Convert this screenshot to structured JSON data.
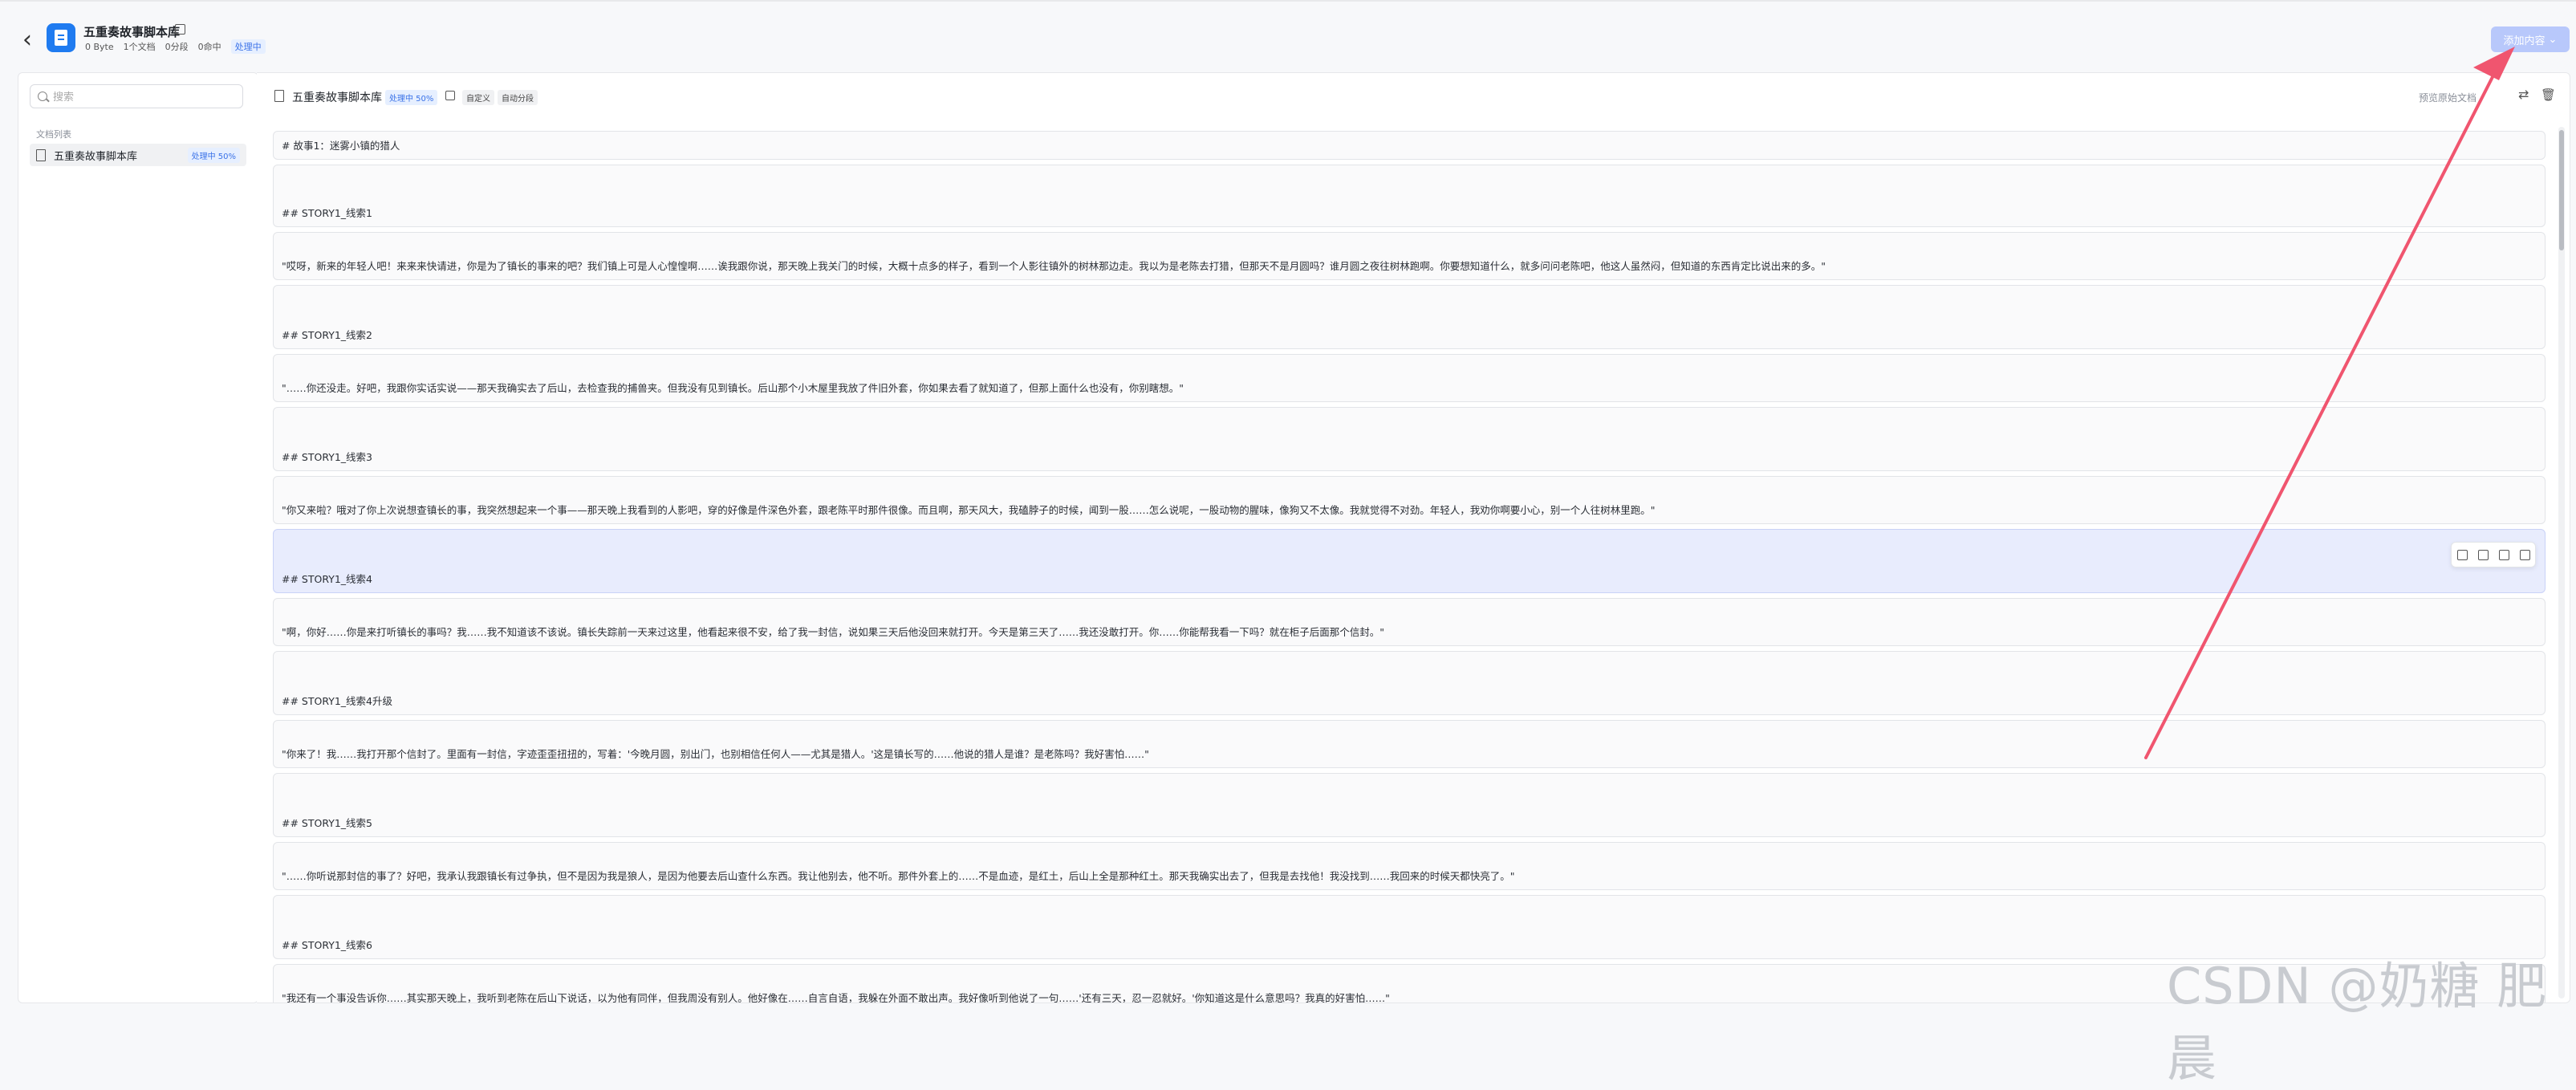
{
  "header": {
    "back_icon": "chevron-left-icon",
    "kb_title": "五重奏故事脚本库",
    "stats": [
      "0 Byte",
      "1个文档",
      "0分段",
      "0命中"
    ],
    "status": "处理中",
    "add_button": "添加内容"
  },
  "sidebar": {
    "search_placeholder": "搜索",
    "list_label": "文档列表",
    "docs": [
      {
        "name": "五重奏故事脚本库",
        "badge": "处理中 50%"
      }
    ]
  },
  "document": {
    "title": "五重奏故事脚本库",
    "progress": "处理中 50%",
    "tags": [
      "自定义",
      "自动分段"
    ],
    "preview_label": "预览原始文档"
  },
  "segments": [
    "# 故事1：迷雾小镇的猎人",
    "## STORY1_线索1",
    "\"哎呀，新来的年轻人吧！来来来快请进，你是为了镇长的事来的吧？我们镇上可是人心惶惶啊……诶我跟你说，那天晚上我关门的时候，大概十点多的样子，看到一个人影往镇外的树林那边走。我以为是老陈去打猎，但那天不是月圆吗？谁月圆之夜往树林跑啊。你要想知道什么，就多问问老陈吧，他这人虽然闷，但知道的东西肯定比说出来的多。\"",
    "## STORY1_线索2",
    "\"……你还没走。好吧，我跟你实话实说——那天我确实去了后山，去检查我的捕兽夹。但我没有见到镇长。后山那个小木屋里我放了件旧外套，你如果去看了就知道了，但那上面什么也没有，你别瞎想。\"",
    "## STORY1_线索3",
    "\"你又来啦？哦对了你上次说想查镇长的事，我突然想起来一个事——那天晚上我看到的人影吧，穿的好像是件深色外套，跟老陈平时那件很像。而且啊，那天风大，我磕脖子的时候，闻到一股……怎么说呢，一股动物的腥味，像狗又不太像。我就觉得不对劲。年轻人，我劝你啊要小心，别一个人往树林里跑。\"",
    "## STORY1_线索4",
    "\"啊，你好……你是来打听镇长的事吗？我……我不知道该不该说。镇长失踪前一天来过这里，他看起来很不安，给了我一封信，说如果三天后他没回来就打开。今天是第三天了……我还没敢打开。你……你能帮我看一下吗？就在柜子后面那个信封。\"",
    "## STORY1_线索4升级",
    "\"你来了！我……我打开那个信封了。里面有一封信，字迹歪歪扭扭的，写着：'今晚月圆，别出门，也别相信任何人——尤其是猎人。'这是镇长写的……他说的猎人是谁？是老陈吗？我好害怕……\"",
    "## STORY1_线索5",
    "\"……你听说那封信的事了？好吧，我承认我跟镇长有过争执，但不是因为我是狼人，是因为他要去后山查什么东西。我让他别去，他不听。那件外套上的……不是血迹，是红土，后山上全是那种红土。那天我确实出去了，但我是去找他！我没找到……我回来的时候天都快亮了。\"",
    "## STORY1_线索6",
    "\"我还有一个事没告诉你……其实那天晚上，我听到老陈在后山下说话，以为他有同伴，但我周没有别人。他好像在……自言自语，我躲在外面不敢出声。我好像听到他说了一句……'还有三天，忍一忍就好。'你知道这是什么意思吗？我真的好害怕……\""
  ],
  "watermark": "CSDN @奶糖 肥晨"
}
